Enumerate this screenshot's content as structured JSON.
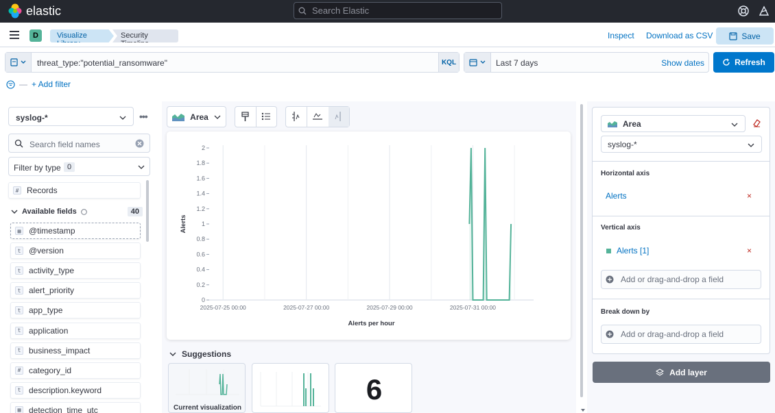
{
  "header": {
    "brand": "elastic",
    "search_placeholder": "Search Elastic"
  },
  "nav": {
    "space_initial": "D",
    "breadcrumbs": [
      "Visualize Library",
      "Security Timeline"
    ],
    "inspect": "Inspect",
    "download": "Download as CSV",
    "save": "Save"
  },
  "query": {
    "text": "threat_type:\"potential_ransomware\"",
    "language": "KQL",
    "date_range": "Last 7 days",
    "show_dates": "Show dates",
    "refresh": "Refresh",
    "add_filter": "+ Add filter"
  },
  "left_panel": {
    "index_pattern": "syslog-*",
    "search_placeholder": "Search field names",
    "filter_by_type": "Filter by type",
    "filter_count": "0",
    "records": "Records",
    "available_fields_label": "Available fields",
    "available_count": "40",
    "fields": [
      {
        "name": "@timestamp",
        "type": "date"
      },
      {
        "name": "@version",
        "type": "t"
      },
      {
        "name": "activity_type",
        "type": "t"
      },
      {
        "name": "alert_priority",
        "type": "t"
      },
      {
        "name": "app_type",
        "type": "t"
      },
      {
        "name": "application",
        "type": "t"
      },
      {
        "name": "business_impact",
        "type": "t"
      },
      {
        "name": "category_id",
        "type": "#"
      },
      {
        "name": "description.keyword",
        "type": "t"
      },
      {
        "name": "detection_time_utc",
        "type": "date"
      }
    ]
  },
  "workspace": {
    "chart_type_label": "Area",
    "suggestions_label": "Suggestions",
    "current_visualization": "Current visualization",
    "metric_suggestion_value": "6"
  },
  "chart_data": {
    "type": "area",
    "title": "",
    "xlabel": "Alerts per hour",
    "ylabel": "Alerts",
    "ylim": [
      0,
      2
    ],
    "y_ticks": [
      "0",
      "0.2",
      "0.4",
      "0.6",
      "0.8",
      "1",
      "1.2",
      "1.4",
      "1.6",
      "1.8",
      "2"
    ],
    "x_ticks": [
      "2025-07-25 00:00",
      "2025-07-27 00:00",
      "2025-07-29 00:00",
      "2025-07-31 00:00"
    ],
    "series": [
      {
        "color": "#54b399",
        "points": [
          {
            "x": "2025-07-30 22:00",
            "y": 1
          },
          {
            "x": "2025-07-30 23:00",
            "y": 2
          },
          {
            "x": "2025-07-31 00:00",
            "y": 0
          },
          {
            "x": "2025-07-31 06:00",
            "y": 0
          },
          {
            "x": "2025-07-31 07:00",
            "y": 2
          },
          {
            "x": "2025-07-31 08:00",
            "y": 0
          },
          {
            "x": "2025-07-31 21:00",
            "y": 0
          },
          {
            "x": "2025-07-31 22:00",
            "y": 1
          }
        ]
      }
    ]
  },
  "right_panel": {
    "chart_type": "Area",
    "index_pattern": "syslog-*",
    "horizontal_axis_label": "Horizontal axis",
    "horizontal_axis_value": "Alerts",
    "vertical_axis_label": "Vertical axis",
    "vertical_axis_value": "Alerts [1]",
    "add_field": "Add or drag-and-drop a field",
    "break_down_label": "Break down by",
    "add_layer": "Add layer"
  },
  "colors": {
    "accent": "#0077cc",
    "series": "#54b399",
    "header_bg": "#25282f"
  }
}
